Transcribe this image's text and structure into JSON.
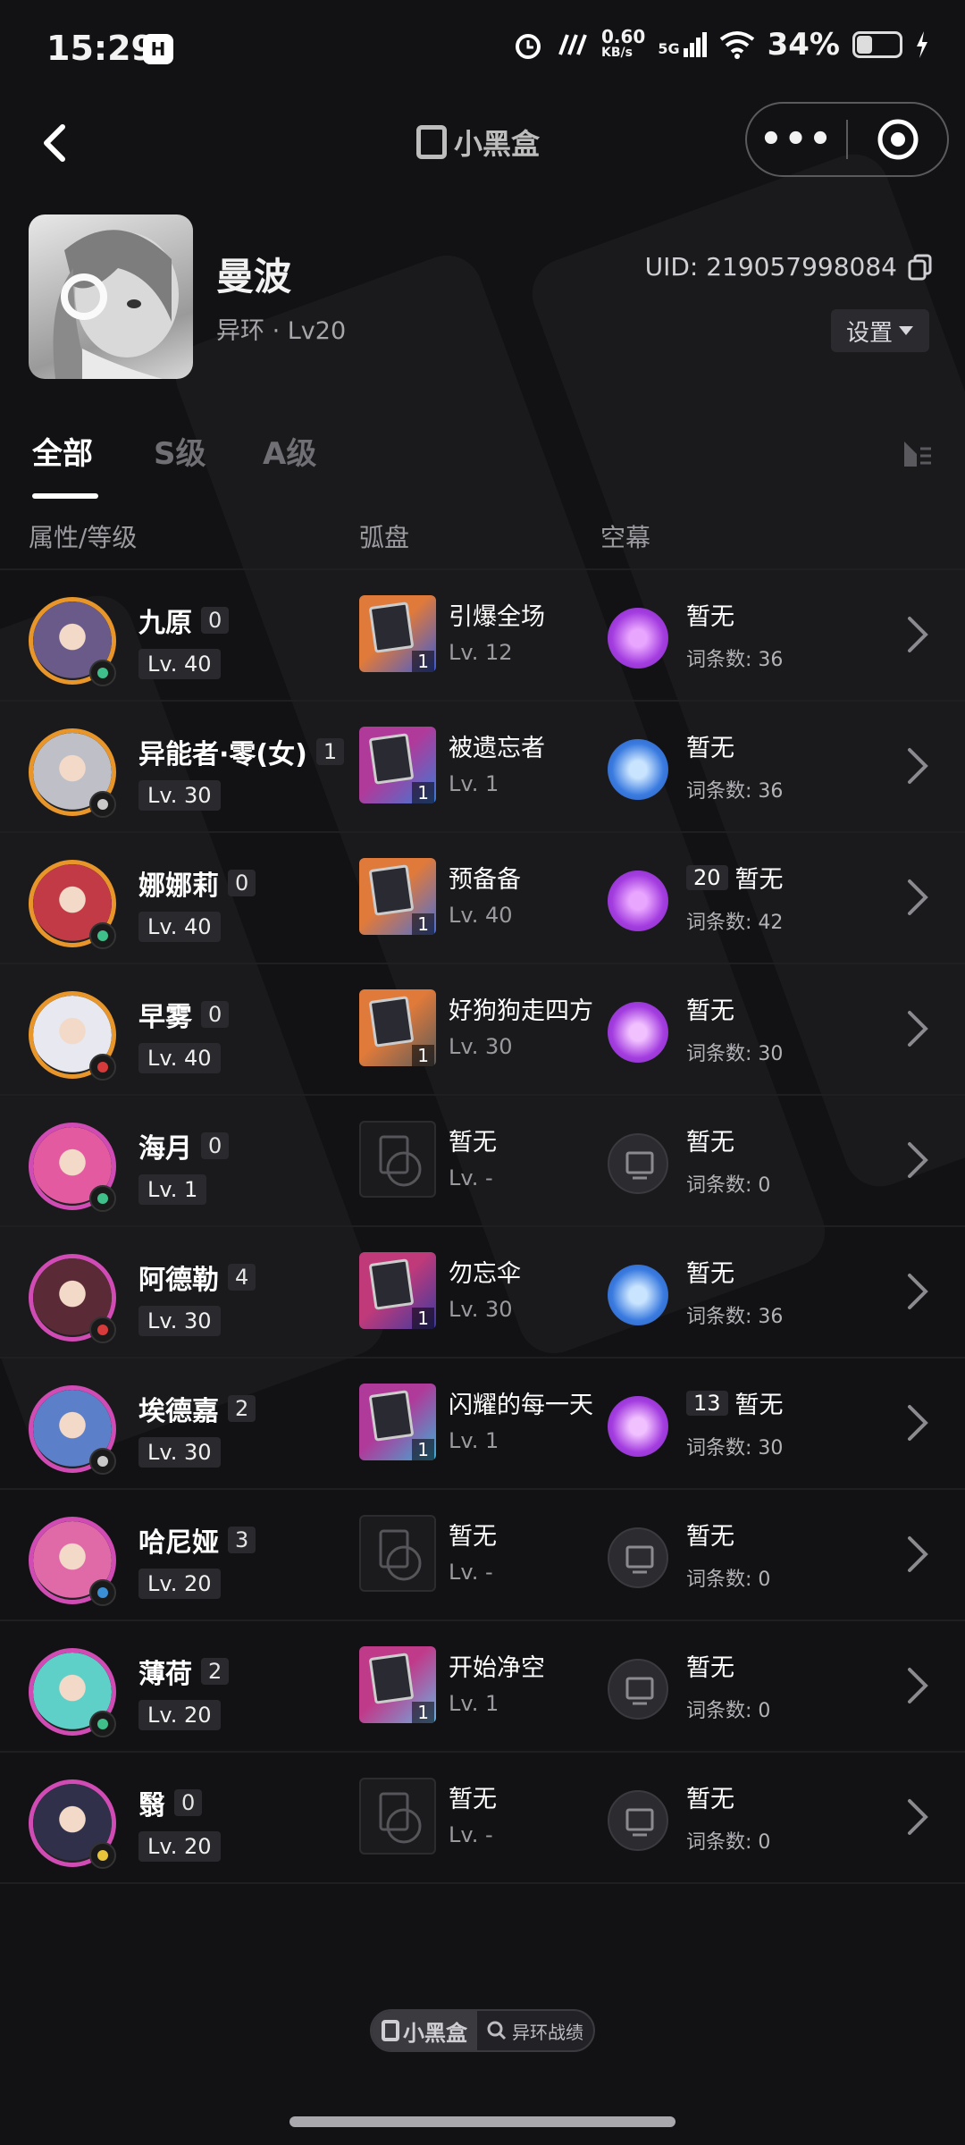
{
  "status_bar": {
    "time": "15:29",
    "speed_value": "0.60",
    "speed_unit": "KB/s",
    "network": "5G",
    "battery_pct": "34%"
  },
  "nav": {
    "logo_text": "小黑盒",
    "menu_label": "•••"
  },
  "profile": {
    "name": "曼波",
    "subtitle": "异环 · Lv20",
    "uid": "UID: 219057998084",
    "settings_label": "设置"
  },
  "tabs": [
    "全部",
    "S级",
    "A级"
  ],
  "columns": {
    "attr": "属性/等级",
    "disc": "弧盘",
    "sky": "空幕"
  },
  "characters": [
    {
      "name": "九原",
      "count": "0",
      "lv": "Lv. 40",
      "disc_name": "引爆全场",
      "disc_lv": "Lv. 12",
      "disc_badge": "1",
      "sky_pre": "",
      "sky_name": "暂无",
      "sky_sub": "词条数: 36"
    },
    {
      "name": "异能者·零(女)",
      "count": "1",
      "lv": "Lv. 30",
      "disc_name": "被遗忘者",
      "disc_lv": "Lv. 1",
      "disc_badge": "1",
      "sky_pre": "",
      "sky_name": "暂无",
      "sky_sub": "词条数: 36"
    },
    {
      "name": "娜娜莉",
      "count": "0",
      "lv": "Lv. 40",
      "disc_name": "预备备",
      "disc_lv": "Lv. 40",
      "disc_badge": "1",
      "sky_pre": "20",
      "sky_name": "暂无",
      "sky_sub": "词条数: 42"
    },
    {
      "name": "早雾",
      "count": "0",
      "lv": "Lv. 40",
      "disc_name": "好狗狗走四方",
      "disc_lv": "Lv. 30",
      "disc_badge": "1",
      "sky_pre": "",
      "sky_name": "暂无",
      "sky_sub": "词条数: 30"
    },
    {
      "name": "海月",
      "count": "0",
      "lv": "Lv. 1",
      "disc_name": "暂无",
      "disc_lv": "Lv. -",
      "disc_badge": "",
      "sky_pre": "",
      "sky_name": "暂无",
      "sky_sub": "词条数: 0"
    },
    {
      "name": "阿德勒",
      "count": "4",
      "lv": "Lv. 30",
      "disc_name": "勿忘伞",
      "disc_lv": "Lv. 30",
      "disc_badge": "1",
      "sky_pre": "",
      "sky_name": "暂无",
      "sky_sub": "词条数: 36"
    },
    {
      "name": "埃德嘉",
      "count": "2",
      "lv": "Lv. 30",
      "disc_name": "闪耀的每一天",
      "disc_lv": "Lv. 1",
      "disc_badge": "1",
      "sky_pre": "13",
      "sky_name": "暂无",
      "sky_sub": "词条数: 30"
    },
    {
      "name": "哈尼娅",
      "count": "3",
      "lv": "Lv. 20",
      "disc_name": "暂无",
      "disc_lv": "Lv. -",
      "disc_badge": "",
      "sky_pre": "",
      "sky_name": "暂无",
      "sky_sub": "词条数: 0"
    },
    {
      "name": "薄荷",
      "count": "2",
      "lv": "Lv. 20",
      "disc_name": "开始净空",
      "disc_lv": "Lv. 1",
      "disc_badge": "1",
      "sky_pre": "",
      "sky_name": "暂无",
      "sky_sub": "词条数: 0"
    },
    {
      "name": "翳",
      "count": "0",
      "lv": "Lv. 20",
      "disc_name": "暂无",
      "disc_lv": "Lv. -",
      "disc_badge": "",
      "sky_pre": "",
      "sky_name": "暂无",
      "sky_sub": "词条数: 0"
    }
  ],
  "footer": {
    "brand": "小黑盒",
    "label": "异环战绩"
  }
}
